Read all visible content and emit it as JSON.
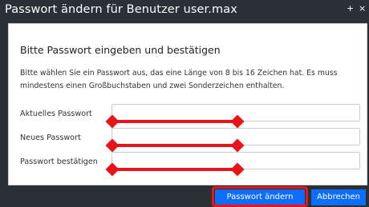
{
  "dialog": {
    "title": "Passwort ändern für Benutzer user.max",
    "heading": "Bitte Passwort eingeben und bestätigen",
    "intro": "Bitte wählen Sie ein Passwort aus, das eine Länge von 8 bis 16 Zeichen hat. Es muss mindestens einen Großbuchstaben und zwei Sonderzeichen enthalten.",
    "fields": [
      {
        "label": "Aktuelles Passwort",
        "value": ""
      },
      {
        "label": "Neues Passwort",
        "value": ""
      },
      {
        "label": "Passwort bestätigen",
        "value": ""
      }
    ],
    "buttons": {
      "primary": "Passwort ändern",
      "cancel": "Abbrechen"
    },
    "title_buttons": {
      "plus": "+",
      "close": "×"
    }
  },
  "icons": {
    "plus": "plus-icon",
    "close": "close-icon"
  },
  "colors": {
    "frame": "#2b3036",
    "accent": "#0d6efd",
    "annotation": "#e8141a"
  }
}
